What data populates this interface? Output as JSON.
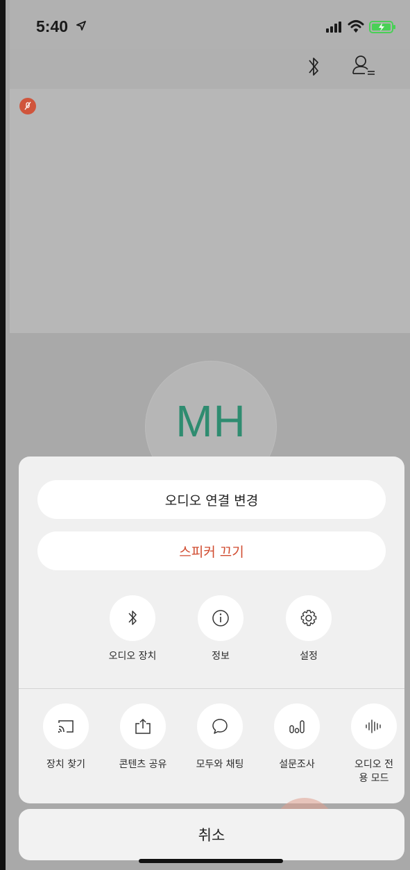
{
  "status_bar": {
    "time": "5:40",
    "location_icon": "location-arrow-icon",
    "signal_icon": "cellular-signal-icon",
    "wifi_icon": "wifi-icon",
    "battery_icon": "battery-charging-icon"
  },
  "header": {
    "bluetooth_icon": "bluetooth-icon",
    "participants_icon": "participants-icon"
  },
  "video": {
    "mute_icon": "mic-muted-icon",
    "avatar_initials": "MH"
  },
  "sheet": {
    "audio_connection_label": "오디오 연결 변경",
    "speaker_off_label": "스피커 끄기",
    "top_actions": [
      {
        "label": "오디오 장치",
        "icon": "bluetooth-icon"
      },
      {
        "label": "정보",
        "icon": "info-icon"
      },
      {
        "label": "설정",
        "icon": "gear-icon"
      }
    ],
    "bottom_actions": [
      {
        "label": "장치 찾기",
        "icon": "cast-icon"
      },
      {
        "label": "콘텐츠 공유",
        "icon": "share-icon"
      },
      {
        "label": "모두와 채팅",
        "icon": "chat-icon"
      },
      {
        "label": "설문조사",
        "icon": "poll-icon"
      },
      {
        "label": "오디오 전 용 모드",
        "icon": "audio-wave-icon"
      }
    ]
  },
  "cancel_label": "취소",
  "colors": {
    "accent_red": "#d04a2e",
    "avatar_green": "#2f8c70",
    "sheet_bg": "#f0f0f0"
  }
}
